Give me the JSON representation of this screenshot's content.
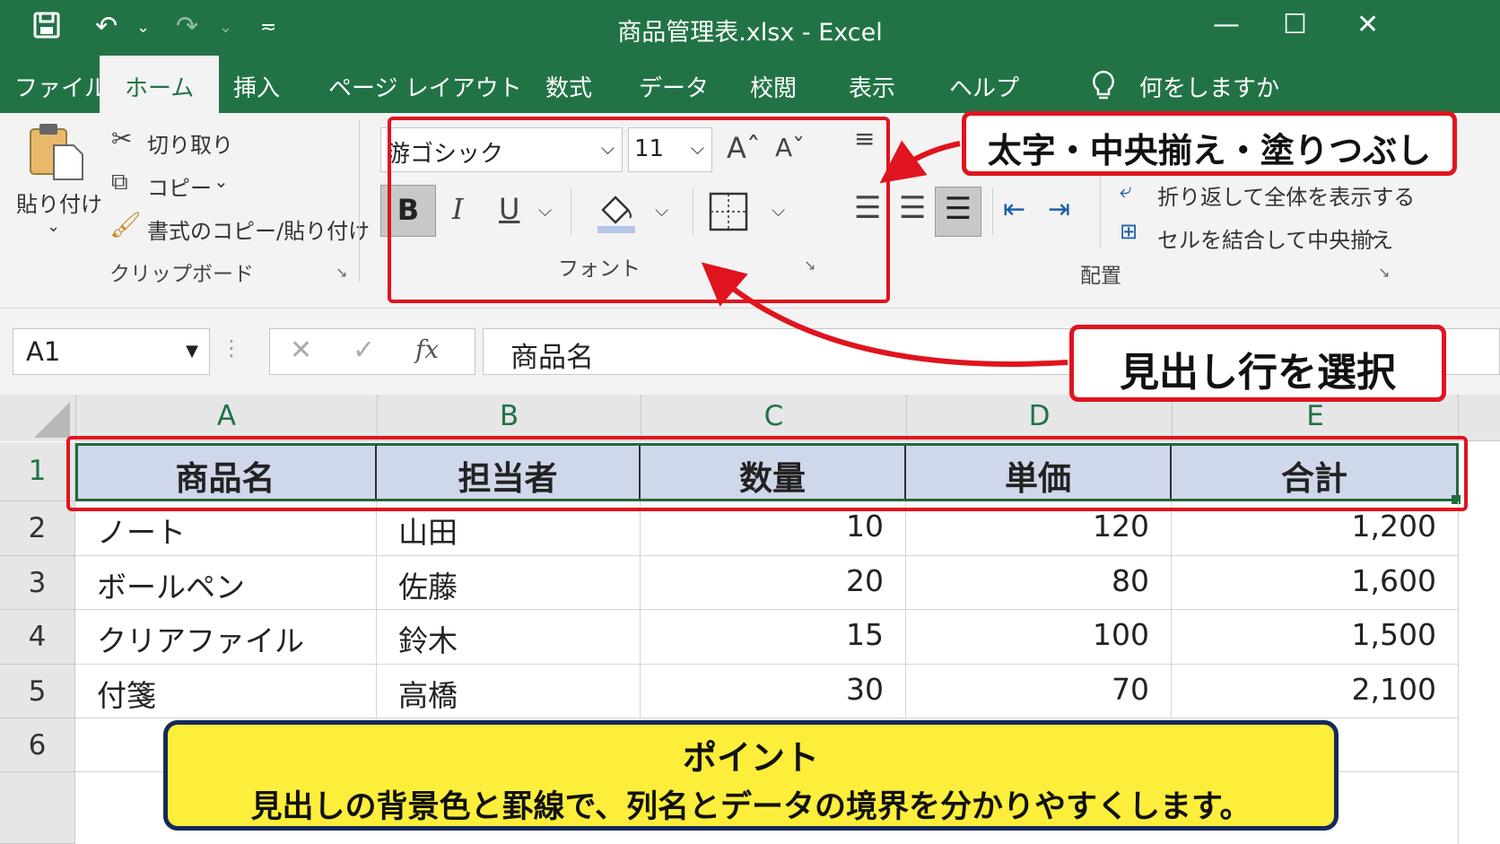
{
  "window": {
    "title": "商品管理表.xlsx  -  Excel"
  },
  "quick_access": {
    "save_icon": "save-icon",
    "undo_icon": "undo-icon",
    "redo_icon": "redo-icon"
  },
  "tabs": [
    "ファイル",
    "ホーム",
    "挿入",
    "ページ レイアウト",
    "数式",
    "データ",
    "校閲",
    "表示",
    "ヘルプ"
  ],
  "tell_me": "何をしますか",
  "clipboard": {
    "paste": "貼り付け",
    "cut": "切り取り",
    "copy": "コピー",
    "format_painter": "書式のコピー/貼り付け",
    "group_label": "クリップボード"
  },
  "font": {
    "font_name": "游ゴシック",
    "font_size": "11",
    "bold": "B",
    "italic": "I",
    "underline": "U",
    "group_label": "フォント"
  },
  "alignment": {
    "wrap_text": "折り返して全体を表示する",
    "merge_center": "セルを結合して中央揃え",
    "group_label": "配置"
  },
  "formula_bar": {
    "name_box": "A1",
    "fx": "fx",
    "formula": "商品名"
  },
  "sheet": {
    "columns": [
      "A",
      "B",
      "C",
      "D",
      "E"
    ],
    "row_numbers": [
      "1",
      "2",
      "3",
      "4",
      "5",
      "6"
    ],
    "header_row": [
      "商品名",
      "担当者",
      "数量",
      "単価",
      "合計"
    ],
    "rows": [
      [
        "ノート",
        "山田",
        "10",
        "120",
        "1,200"
      ],
      [
        "ボールペン",
        "佐藤",
        "20",
        "80",
        "1,600"
      ],
      [
        "クリアファイル",
        "鈴木",
        "15",
        "100",
        "1,500"
      ],
      [
        "付箋",
        "高橋",
        "30",
        "70",
        "2,100"
      ]
    ]
  },
  "annotations": {
    "font_callout": "太字・中央揃え・塗りつぶし",
    "select_callout": "見出し行を選択",
    "note_title": "ポイント",
    "note_body": "見出しの背景色と罫線で、列名とデータの境界を分かりやすくします。"
  },
  "colors": {
    "excel_green": "#217346",
    "header_fill": "#cfd8ea",
    "callout_red": "#e0141e",
    "note_yellow": "#fcee3a"
  }
}
